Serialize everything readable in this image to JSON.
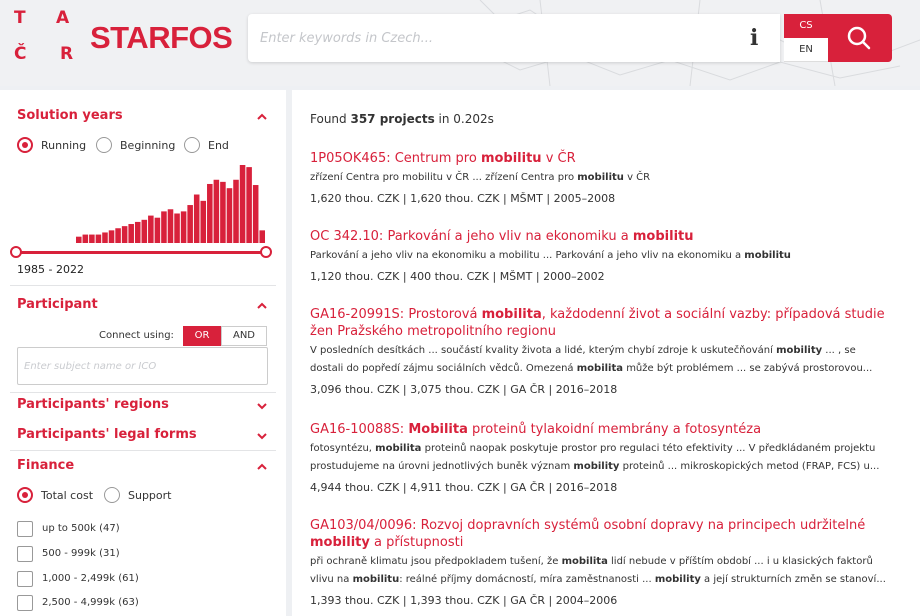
{
  "header": {
    "logo_letters": [
      "T",
      "A",
      "Č",
      "R"
    ],
    "brand": "STARFOS",
    "search_placeholder": "Enter keywords in Czech...",
    "lang_options": [
      "CS",
      "EN"
    ],
    "active_lang": "CS",
    "accent_color": "#d8213b"
  },
  "sidebar": {
    "solution_years": {
      "title": "Solution years",
      "radios": [
        "Running",
        "Beginning",
        "End"
      ],
      "selected": "Running",
      "range_label": "1985 - 2022",
      "histogram": {
        "values": [
          6,
          8,
          8,
          8,
          10,
          12,
          14,
          16,
          18,
          20,
          22,
          26,
          24,
          30,
          32,
          28,
          30,
          36,
          46,
          40,
          56,
          60,
          58,
          52,
          60,
          74,
          72,
          55,
          12
        ]
      }
    },
    "participant": {
      "title": "Participant",
      "connect_label": "Connect using:",
      "or_label": "OR",
      "and_label": "AND",
      "subject_placeholder": "Enter subject name or IČO"
    },
    "participants_regions": {
      "title": "Participants' regions"
    },
    "participants_legal_forms": {
      "title": "Participants' legal forms"
    },
    "finance": {
      "title": "Finance",
      "radios": [
        "Total cost",
        "Support"
      ],
      "selected": "Total cost",
      "checkboxes": [
        "up to 500k (47)",
        "500 - 999k (31)",
        "1,000 - 2,499k (61)",
        "2,500 - 4,999k (63)"
      ]
    }
  },
  "results": {
    "found_prefix": "Found",
    "found_count": "357 projects",
    "found_suffix": "in 0.202s",
    "items": [
      {
        "title_html": "1P05OK465: Centrum pro <b>mobilitu</b> v ČR",
        "snippet_html": "zřízení Centra pro mobilitu v ČR ... zřízení Centra pro <b>mobilitu</b> v ČR",
        "meta": "1,620 thou. CZK | 1,620 thou. CZK | MŠMT | 2005–2008"
      },
      {
        "title_html": "OC 342.10: Parkování a jeho vliv na ekonomiku a <b>mobilitu</b>",
        "snippet_html": "Parkování a jeho vliv na ekonomiku a mobilitu ... Parkování a jeho vliv na ekonomiku a <b>mobilitu</b>",
        "meta": "1,120 thou. CZK | 400 thou. CZK | MŠMT | 2000–2002"
      },
      {
        "title_html": "GA16-20991S: Prostorová <b>mobilita</b>, každodenní život a sociální vazby: případová studie žen Pražského metropolitního regionu",
        "snippet_html": "V posledních desítkách ... součástí kvality života a lidé, kterým chybí zdroje k uskutečňování <b>mobility</b> ... , se<br>dostali do popředí zájmu sociálních vědců. Omezená <b>mobilita</b> může být problémem ... se zabývá prostorovou...",
        "meta": "3,096 thou. CZK | 3,075 thou. CZK | GA ČR | 2016–2018"
      },
      {
        "title_html": "GA16-10088S: <b>Mobilita</b> proteinů tylakoidní membrány a fotosyntéza",
        "snippet_html": "fotosyntézu, <b>mobilita</b> proteinů naopak poskytuje prostor pro regulaci této efektivity ... V předkládaném projektu<br>prostudujeme na úrovni jednotlivých buněk význam <b>mobility</b> proteinů ... mikroskopických metod (FRAP, FCS) u...",
        "meta": "4,944 thou. CZK | 4,911 thou. CZK | GA ČR | 2016–2018"
      },
      {
        "title_html": "GA103/04/0096: Rozvoj dopravních systémů osobní dopravy na principech udržitelné <b>mobility</b> a přístupnosti",
        "snippet_html": "při ochraně klimatu jsou předpokladem tušení, že <b>mobilita</b> lidí nebude v příštím období ... i u klasických faktorů<br>vlivu na <b>mobilitu</b>: reálné příjmy domácností, míra zaměstnanosti ... <b>mobility</b> a její strukturních změn se stanoví...",
        "meta": "1,393 thou. CZK | 1,393 thou. CZK | GA ČR | 2004–2006"
      }
    ]
  }
}
